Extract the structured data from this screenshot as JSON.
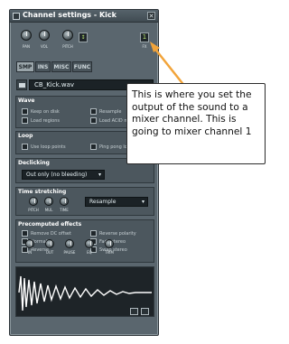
{
  "window": {
    "title": "Channel settings - Kick",
    "close_label": "✕"
  },
  "knobs": [
    {
      "label": "PAN"
    },
    {
      "label": "VOL"
    },
    {
      "label": "PITCH"
    }
  ],
  "knob_extra_icon": "range-icon",
  "mixer_track": {
    "label": "FX",
    "value": "1"
  },
  "tabs": [
    {
      "label": "SMP",
      "active": true
    },
    {
      "label": "INS",
      "active": false
    },
    {
      "label": "MISC",
      "active": false
    },
    {
      "label": "FUNC",
      "active": false
    }
  ],
  "file": {
    "name": "CB_Kick.wav",
    "dropdown_icon": "▾"
  },
  "wave_section": {
    "title": "Wave",
    "options": [
      {
        "label": "Keep on disk",
        "checked": false
      },
      {
        "label": "Resample",
        "checked": false
      },
      {
        "label": "Load regions",
        "checked": false
      },
      {
        "label": "Load ACID markers",
        "checked": false
      }
    ]
  },
  "loop_section": {
    "title": "Loop",
    "options": [
      {
        "label": "Use loop points",
        "checked": false
      },
      {
        "label": "Ping pong loop",
        "checked": false
      }
    ]
  },
  "declicking": {
    "title": "Declicking",
    "value": "Out only (no bleeding)"
  },
  "time_stretching": {
    "title": "Time stretching",
    "knobs": [
      "PITCH",
      "MUL",
      "TIME"
    ],
    "mode": "Resample"
  },
  "precomputed": {
    "title": "Precomputed effects",
    "options": [
      {
        "label": "Remove DC offset",
        "checked": false
      },
      {
        "label": "Reverse polarity",
        "checked": false
      },
      {
        "label": "Normalize",
        "checked": false
      },
      {
        "label": "Fade stereo",
        "checked": false
      },
      {
        "label": "Reverse",
        "checked": false
      },
      {
        "label": "Swap stereo",
        "checked": false
      }
    ],
    "knobs": [
      "IN",
      "OUT",
      "PAUSE",
      "EQ",
      "TRIM"
    ]
  },
  "callout": {
    "text": "This is where you set the output of the sound to a mixer channel. This is going to mixer channel 1"
  },
  "colors": {
    "window_bg": "#5a666e",
    "accent_orange": "#ff6a2a",
    "arrow": "#f2a43a",
    "wave": "#ffffff"
  }
}
